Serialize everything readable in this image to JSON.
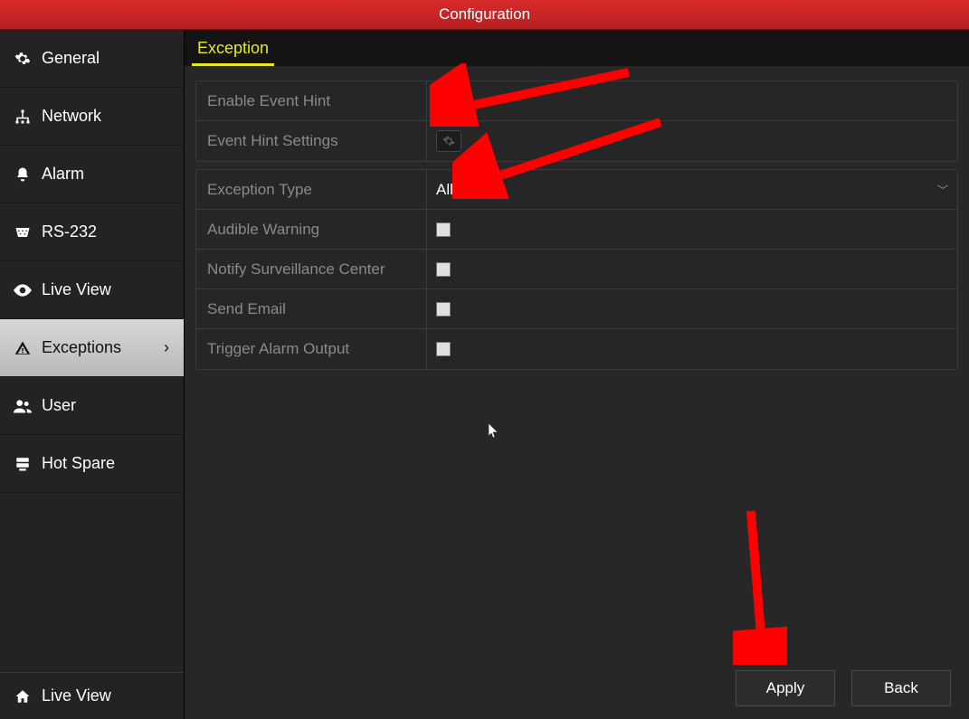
{
  "titlebar": {
    "title": "Configuration"
  },
  "sidebar": {
    "items": [
      {
        "id": "general",
        "label": "General",
        "icon": "gear-icon"
      },
      {
        "id": "network",
        "label": "Network",
        "icon": "network-icon"
      },
      {
        "id": "alarm",
        "label": "Alarm",
        "icon": "bell-icon"
      },
      {
        "id": "rs232",
        "label": "RS-232",
        "icon": "serial-icon"
      },
      {
        "id": "liveview",
        "label": "Live View",
        "icon": "eye-icon"
      },
      {
        "id": "exceptions",
        "label": "Exceptions",
        "icon": "warning-icon",
        "selected": true
      },
      {
        "id": "user",
        "label": "User",
        "icon": "users-icon"
      },
      {
        "id": "hotspare",
        "label": "Hot Spare",
        "icon": "hotspare-icon"
      }
    ],
    "bottom": {
      "label": "Live View",
      "icon": "home-icon"
    }
  },
  "main": {
    "tab": {
      "label": "Exception"
    },
    "block1": {
      "rows": [
        {
          "label": "Enable Event Hint",
          "type": "checkbox"
        },
        {
          "label": "Event Hint Settings",
          "type": "gear"
        }
      ]
    },
    "block2": {
      "rows": [
        {
          "label": "Exception Type",
          "type": "select",
          "value": "All"
        },
        {
          "label": "Audible Warning",
          "type": "checkbox"
        },
        {
          "label": "Notify Surveillance Center",
          "type": "checkbox"
        },
        {
          "label": "Send Email",
          "type": "checkbox"
        },
        {
          "label": "Trigger Alarm Output",
          "type": "checkbox"
        }
      ]
    }
  },
  "buttons": {
    "apply": "Apply",
    "back": "Back"
  }
}
